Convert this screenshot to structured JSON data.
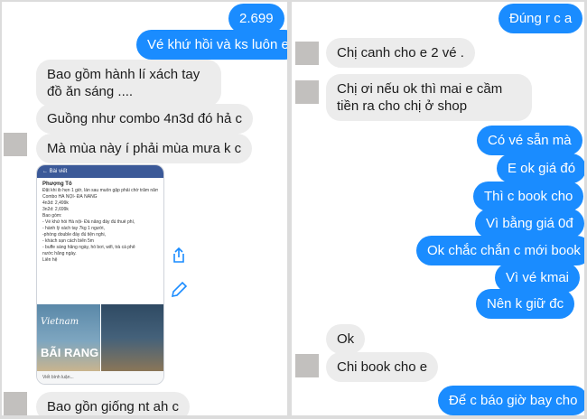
{
  "left": {
    "messages": [
      {
        "side": "out",
        "text": "2.699"
      },
      {
        "side": "out",
        "text": "Vé khứ hồi và ks luôn e"
      },
      {
        "side": "in",
        "text": "Bao gồm hành lí xách tay đồ ăn sáng ...."
      },
      {
        "side": "in",
        "text": "Guồng như combo 4n3d đó hả c"
      },
      {
        "side": "in",
        "text": "Mà mùa này  í phải mùa mưa k c"
      },
      {
        "side": "in",
        "text": "Bao gồn giống nt ah c"
      }
    ],
    "shared_post": {
      "header": "Bài viết",
      "author": "Phượng Tô",
      "lines": [
        "Đặt khi ib hẹn 1 giờ, lần sau muốn gặp phải chờ trăm năm,",
        "Combo HÀ NỘI- ĐÀ NẴNG",
        "4n3d: 2,499k",
        "3n2d: 2,699k",
        "Bao gồm:",
        "- Vé khứ hồi Hà nội- Đà nẵng đầy đủ thuế phí,",
        "- hành lý xách tay 7kg 1 người,",
        "-phòng double đầy đủ tiện nghi,",
        "- khách sạn cách biển 5m",
        "- buffe sáng hằng ngày, hồ bơi, wifi, trà cà phê",
        "nước hằng ngày.",
        "Liên hệ"
      ],
      "image_caption_1": "Vietnam",
      "image_caption_2": "BÃI RANG",
      "footer": "Viết bình luận..."
    },
    "side_icons": [
      "share-icon",
      "edit-icon"
    ]
  },
  "right": {
    "messages": [
      {
        "side": "out",
        "text": "Đúng r c a"
      },
      {
        "side": "in",
        "text": "Chị canh cho e 2 vé ."
      },
      {
        "side": "in",
        "text": "Chị ơi nếu ok thì mai e cầm tiền ra cho chị ở shop"
      },
      {
        "side": "out",
        "text": "Có vé sẵn mà"
      },
      {
        "side": "out",
        "text": "E ok giá đó"
      },
      {
        "side": "out",
        "text": "Thì c book cho"
      },
      {
        "side": "out",
        "text": "Vì bằng giá 0đ"
      },
      {
        "side": "out",
        "text": "Ok chắc chắn c mới book"
      },
      {
        "side": "out",
        "text": "Vì vé kmai"
      },
      {
        "side": "out",
        "text": "Nên k giữ đc"
      },
      {
        "side": "in",
        "text": "Ok"
      },
      {
        "side": "in",
        "text": "Chi book cho e"
      },
      {
        "side": "out",
        "text": "Để c báo giờ bay cho"
      }
    ]
  },
  "colors": {
    "outgoing": "#1a8cff",
    "incoming": "#ececec",
    "post_bar": "#3b5998"
  }
}
